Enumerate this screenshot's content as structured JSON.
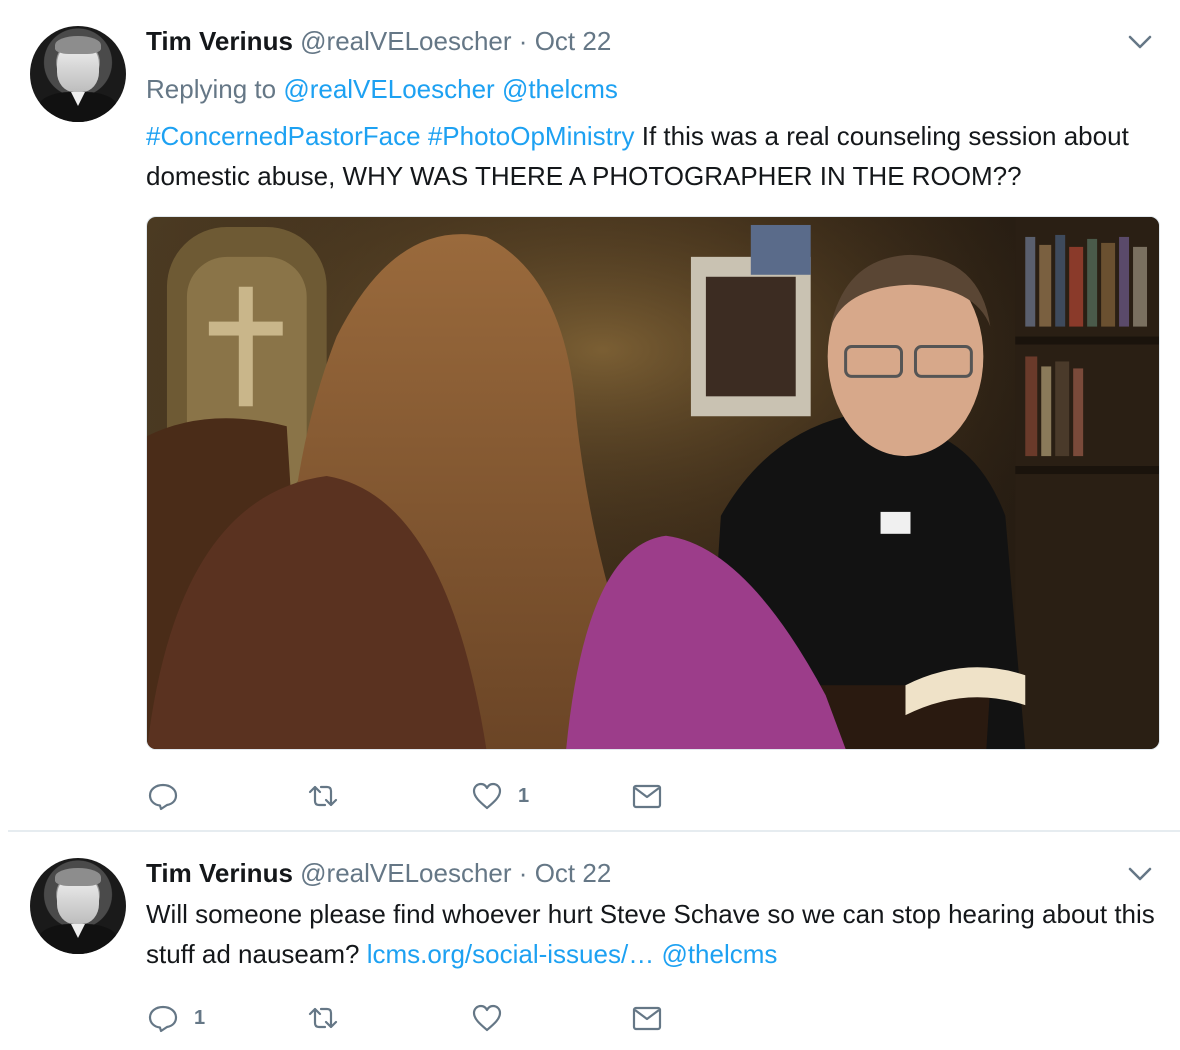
{
  "tweets": [
    {
      "name": "Tim Verinus",
      "handle": "@realVELoescher",
      "separator": "·",
      "date": "Oct 22",
      "replying_prefix": "Replying to",
      "replying_to": [
        "@realVELoescher",
        "@thelcms"
      ],
      "hashtags": [
        "#ConcernedPastorFace",
        "#PhotoOpMinistry"
      ],
      "text": "If this was a real counseling session about domestic abuse, WHY WAS THERE A PHOTOGRAPHER IN THE ROOM??",
      "has_media": true,
      "actions": {
        "reply_count": "",
        "retweet_count": "",
        "like_count": "1"
      }
    },
    {
      "name": "Tim Verinus",
      "handle": "@realVELoescher",
      "separator": "·",
      "date": "Oct 22",
      "text": "Will someone please find whoever hurt Steve Schave so we can stop hearing about this stuff ad nauseam?",
      "link": "lcms.org/social-issues/…",
      "mention": "@thelcms",
      "actions": {
        "reply_count": "1",
        "retweet_count": "",
        "like_count": ""
      }
    }
  ],
  "icons": {
    "reply": "reply-icon",
    "retweet": "retweet-icon",
    "like": "heart-icon",
    "dm": "envelope-icon",
    "more": "chevron-down-icon"
  },
  "colors": {
    "text": "#14171a",
    "muted": "#657786",
    "link": "#1da1f2",
    "divider": "#e6ecf0"
  }
}
